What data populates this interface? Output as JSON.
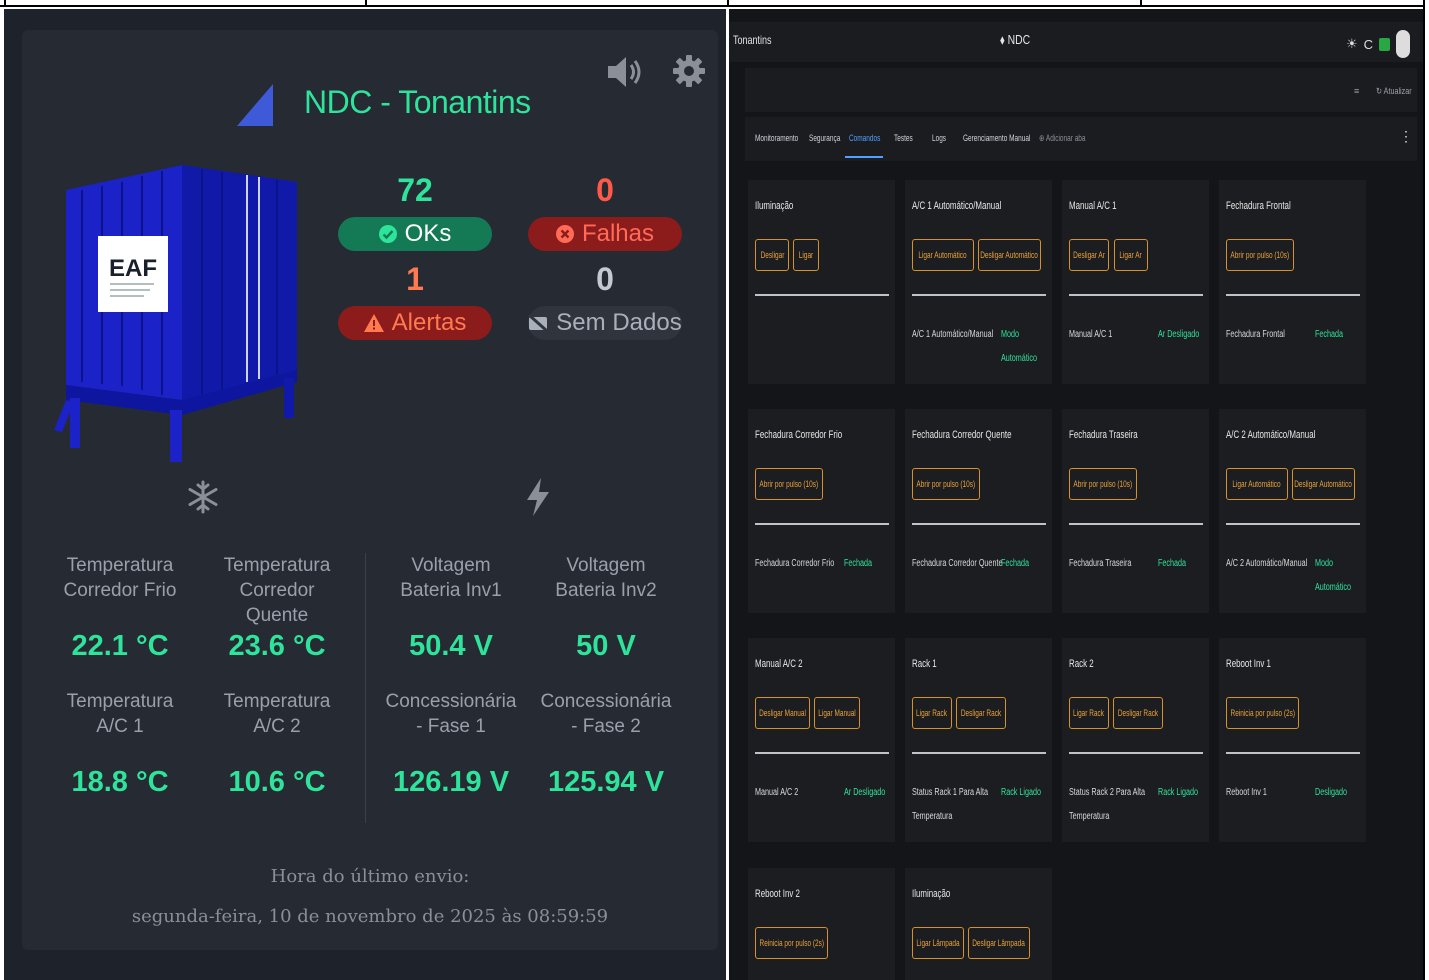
{
  "dashboard": {
    "title": "NDC - Tonantins",
    "container_logo": "EAF",
    "stats": {
      "oks_count": "72",
      "oks_label": "OKs",
      "falhas_count": "0",
      "falhas_label": "Falhas",
      "alertas_count": "1",
      "alertas_label": "Alertas",
      "sem_dados_count": "0",
      "sem_dados_label": "Sem Dados"
    },
    "metrics": [
      {
        "label_line1": "Temperatura",
        "label_line2": "Corredor Frio",
        "label_line3": "",
        "value": "22.1 °C"
      },
      {
        "label_line1": "Temperatura",
        "label_line2": "Corredor",
        "label_line3": "Quente",
        "value": "23.6 °C"
      },
      {
        "label_line1": "Voltagem",
        "label_line2": "Bateria Inv1",
        "label_line3": "",
        "value": "50.4 V"
      },
      {
        "label_line1": "Voltagem",
        "label_line2": "Bateria Inv2",
        "label_line3": "",
        "value": "50 V"
      },
      {
        "label_line1": "Temperatura",
        "label_line2": "A/C 1",
        "label_line3": "",
        "value": "18.8 °C"
      },
      {
        "label_line1": "Temperatura",
        "label_line2": "A/C 2",
        "label_line3": "",
        "value": "10.6 °C"
      },
      {
        "label_line1": "Concessionária",
        "label_line2": "- Fase 1",
        "label_line3": "",
        "value": "126.19 V"
      },
      {
        "label_line1": "Concessionária",
        "label_line2": "- Fase 2",
        "label_line3": "",
        "value": "125.94 V"
      }
    ],
    "last_send_label": "Hora do último envio:",
    "last_send_value": "segunda-feira, 10 de novembro de 2025 às 08:59:59"
  },
  "colors": {
    "accent_green": "#2ee39a",
    "danger_red": "#8c1b1b",
    "warning_orange": "#d79124",
    "tab_blue": "#4ea1ff"
  },
  "icons": {
    "sound": "speaker-icon",
    "settings": "gear-icon",
    "temperature": "snowflake-icon",
    "power": "lightning-icon"
  },
  "control_panel": {
    "location": "Tonantins",
    "app_title": "NDC",
    "top_icons": [
      "☀",
      "C"
    ],
    "update_label": "Atualizar",
    "tabs": [
      "Monitoramento",
      "Segurança",
      "Comandos",
      "Testes",
      "Logs",
      "Gerenciamento Manual"
    ],
    "active_tab": "Comandos",
    "add_tab_label": "Adicionar aba",
    "cards": [
      {
        "title": "Iluminação",
        "buttons": [
          "Desligar",
          "Ligar"
        ],
        "status_label": "",
        "status_value": ""
      },
      {
        "title": "A/C 1 Automático/Manual",
        "buttons": [
          "Ligar Automático",
          "Desligar Automático"
        ],
        "status_label": "A/C 1 Automático/Manual",
        "status_value": "Modo Automático"
      },
      {
        "title": "Manual A/C 1",
        "buttons": [
          "Desligar Ar",
          "Ligar Ar"
        ],
        "status_label": "Manual A/C 1",
        "status_value": "Ar Desligado"
      },
      {
        "title": "Fechadura Frontal",
        "buttons": [
          "Abrir por pulso (10s)"
        ],
        "status_label": "Fechadura Frontal",
        "status_value": "Fechada"
      },
      {
        "title": "Fechadura Corredor Frio",
        "buttons": [
          "Abrir por pulso (10s)"
        ],
        "status_label": "Fechadura Corredor Frio",
        "status_value": "Fechada"
      },
      {
        "title": "Fechadura Corredor Quente",
        "buttons": [
          "Abrir por pulso (10s)"
        ],
        "status_label": "Fechadura Corredor Quente",
        "status_value": "Fechada"
      },
      {
        "title": "Fechadura Traseira",
        "buttons": [
          "Abrir por pulso (10s)"
        ],
        "status_label": "Fechadura Traseira",
        "status_value": "Fechada"
      },
      {
        "title": "A/C 2 Automático/Manual",
        "buttons": [
          "Ligar Automático",
          "Desligar Automático"
        ],
        "status_label": "A/C 2 Automático/Manual",
        "status_value": "Modo Automático"
      },
      {
        "title": "Manual A/C 2",
        "buttons": [
          "Desligar Manual",
          "Ligar Manual"
        ],
        "status_label": "Manual A/C 2",
        "status_value": "Ar Desligado"
      },
      {
        "title": "Rack 1",
        "buttons": [
          "Ligar Rack",
          "Desligar Rack"
        ],
        "status_label": "Status Rack 1 Para Alta Temperatura",
        "status_value": "Rack Ligado"
      },
      {
        "title": "Rack 2",
        "buttons": [
          "Ligar Rack",
          "Desligar Rack"
        ],
        "status_label": "Status Rack 2 Para Alta Temperatura",
        "status_value": "Rack Ligado"
      },
      {
        "title": "Reboot Inv 1",
        "buttons": [
          "Reinicia por pulso (2s)"
        ],
        "status_label": "Reboot Inv 1",
        "status_value": "Desligado"
      },
      {
        "title": "Reboot Inv 2",
        "buttons": [
          "Reinicia por pulso (2s)"
        ],
        "status_label": "",
        "status_value": ""
      },
      {
        "title": "Iluminação",
        "buttons": [
          "Ligar Lâmpada",
          "Desligar Lâmpada"
        ],
        "status_label": "",
        "status_value": ""
      }
    ]
  }
}
